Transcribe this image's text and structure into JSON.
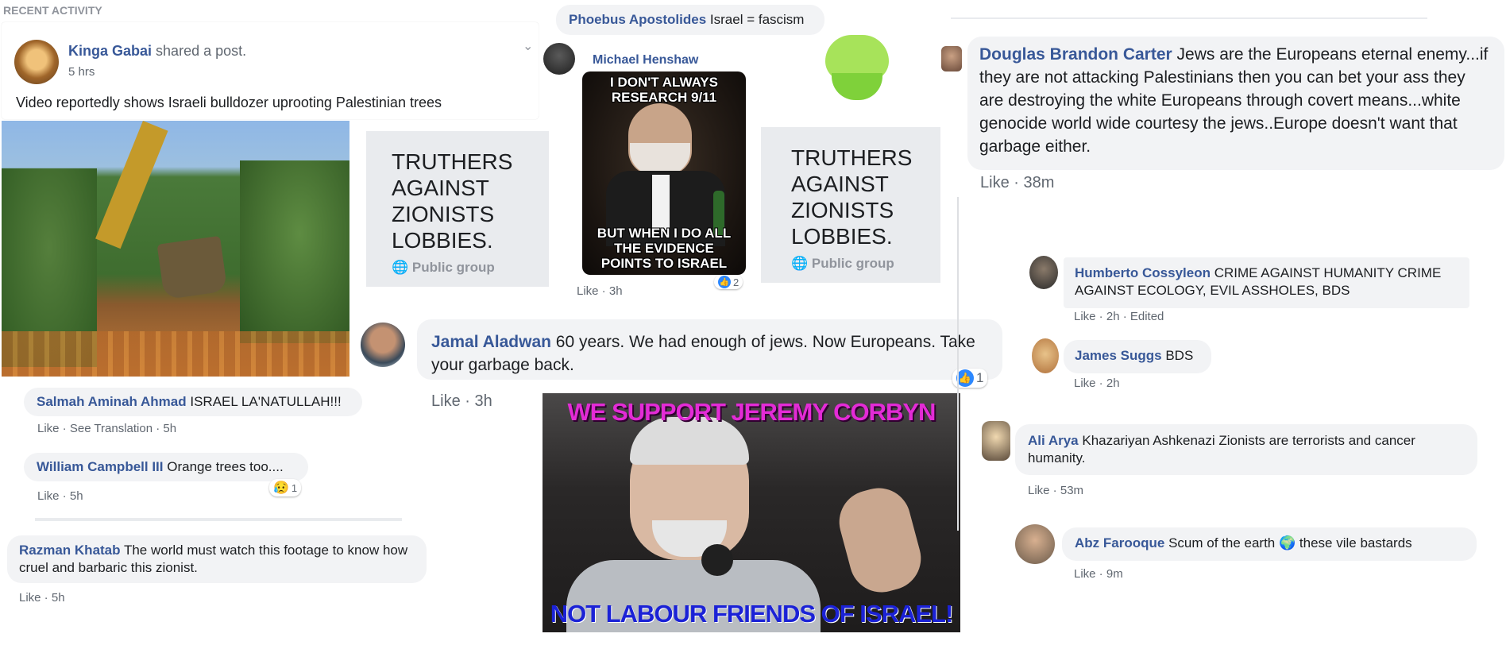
{
  "left_post": {
    "section_header": "RECENT ACTIVITY",
    "author": "Kinga Gabai",
    "action": "shared a post.",
    "time": "5 hrs",
    "text": "Video reportedly shows Israeli bulldozer uprooting Palestinian trees"
  },
  "left_comments": [
    {
      "name": "Salmah Aminah Ahmad",
      "text": "ISRAEL LA'NATULLAH!!!",
      "meta": "Like · See Translation · 5h"
    },
    {
      "name": "William Campbell III",
      "text": "Orange trees too....",
      "meta": "Like · 5h",
      "reaction_count": "1"
    },
    {
      "name": "Razman Khatab",
      "text": "The world must watch this footage to know how cruel and barbaric this zionist.",
      "meta": "Like · 5h"
    }
  ],
  "group_card_1": {
    "title": "TRUTHERS AGAINST ZIONISTS LOBBIES.",
    "type": "Public group"
  },
  "group_card_2": {
    "title": "TRUTHERS AGAINST ZIONISTS LOBBIES.",
    "type": "Public group"
  },
  "phoebus": {
    "name": "Phoebus Apostolides",
    "text": "Israel = fascism"
  },
  "henshaw": {
    "name": "Michael Henshaw",
    "meme_top": "I DON'T ALWAYS RESEARCH 9/11",
    "meme_bottom": "BUT WHEN I DO ALL THE EVIDENCE POINTS TO ISRAEL",
    "meta": "Like · 3h",
    "reaction_count": "2"
  },
  "jamal": {
    "name": "Jamal Aladwan",
    "text": "60 years. We had enough of jews. Now Europeans. Take your garbage back.",
    "meta": "Like · 3h",
    "reaction_count": "1"
  },
  "corbyn_meme": {
    "top": "WE SUPPORT JEREMY CORBYN",
    "bottom": "NOT LABOUR FRIENDS OF ISRAEL!"
  },
  "douglas": {
    "name": "Douglas Brandon Carter",
    "text": "Jews are the Europeans eternal enemy...if they are not attacking Palestinians then you can bet your ass they are destroying the white Europeans through covert means...white genocide world wide courtesy the jews..Europe doesn't want that garbage either.",
    "meta": "Like · 38m"
  },
  "right_comments": [
    {
      "name": "Humberto Cossyleon",
      "text": "CRIME AGAINST HUMANITY CRIME AGAINST ECOLOGY, EVIL ASSHOLES, BDS",
      "meta": "Like · 2h · Edited"
    },
    {
      "name": "James Suggs",
      "text": "BDS",
      "meta": "Like · 2h"
    },
    {
      "name": "Ali Arya",
      "text": "Khazariyan Ashkenazi Zionists are terrorists and cancer humanity.",
      "meta": "Like · 53m"
    },
    {
      "name": "Abz Farooque",
      "text_before": "Scum of the earth",
      "emoji": "🌍",
      "text_after": "these vile bastards",
      "meta": "Like · 9m"
    }
  ],
  "colors": {
    "link": "#385898",
    "bubble": "#f2f3f5",
    "meme_magenta": "#e32bd6",
    "meme_blue": "#1b22d6",
    "like_blue": "#2d88ff"
  }
}
